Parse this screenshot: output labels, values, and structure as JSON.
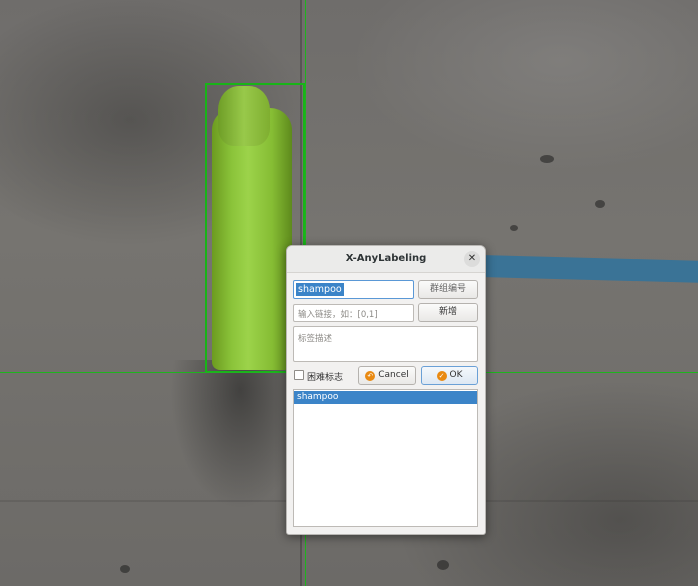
{
  "dialog": {
    "title": "X-AnyLabeling",
    "close_icon": "close-icon",
    "label_value": "shampoo",
    "group_button": "群组编号",
    "link_placeholder": "输入链接，如：[0,1]",
    "add_button": "新增",
    "description_placeholder": "标签描述",
    "difficult_label": "困难标志",
    "difficult_checked": false,
    "cancel_label": "Cancel",
    "cancel_icon": "cancel-icon",
    "ok_label": "OK",
    "ok_icon": "ok-icon",
    "labels": [
      {
        "label": "shampoo",
        "selected": true
      }
    ]
  },
  "canvas": {
    "bbox_color": "#18b418",
    "crosshair_color": "#1eb41e"
  }
}
